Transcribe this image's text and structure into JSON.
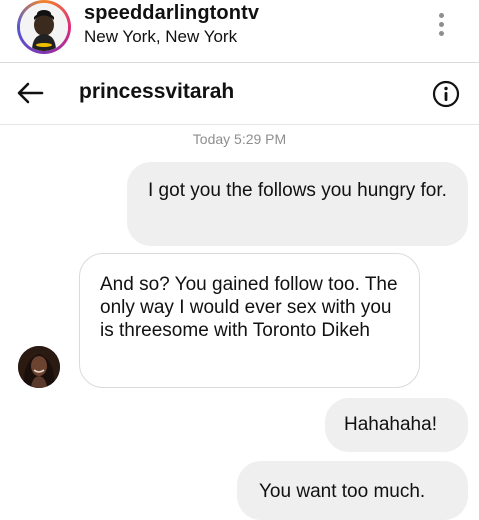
{
  "post": {
    "username": "speeddarlingtontv",
    "location": "New York, New York"
  },
  "dm": {
    "title": "princessvitarah"
  },
  "conversation": {
    "timestamp": "Today 5:29 PM",
    "messages": [
      {
        "direction": "outgoing",
        "text": "I got you the follows you hungry for."
      },
      {
        "direction": "incoming",
        "text": "And so? You gained follow too. The only way I would ever sex with you is threesome with Toronto Dikeh"
      },
      {
        "direction": "outgoing",
        "text": "Hahahaha!"
      },
      {
        "direction": "outgoing",
        "text": "You want too much."
      }
    ]
  },
  "icons": {
    "post_more": "more-vertical-icon",
    "back": "back-arrow-icon",
    "info": "info-icon"
  }
}
